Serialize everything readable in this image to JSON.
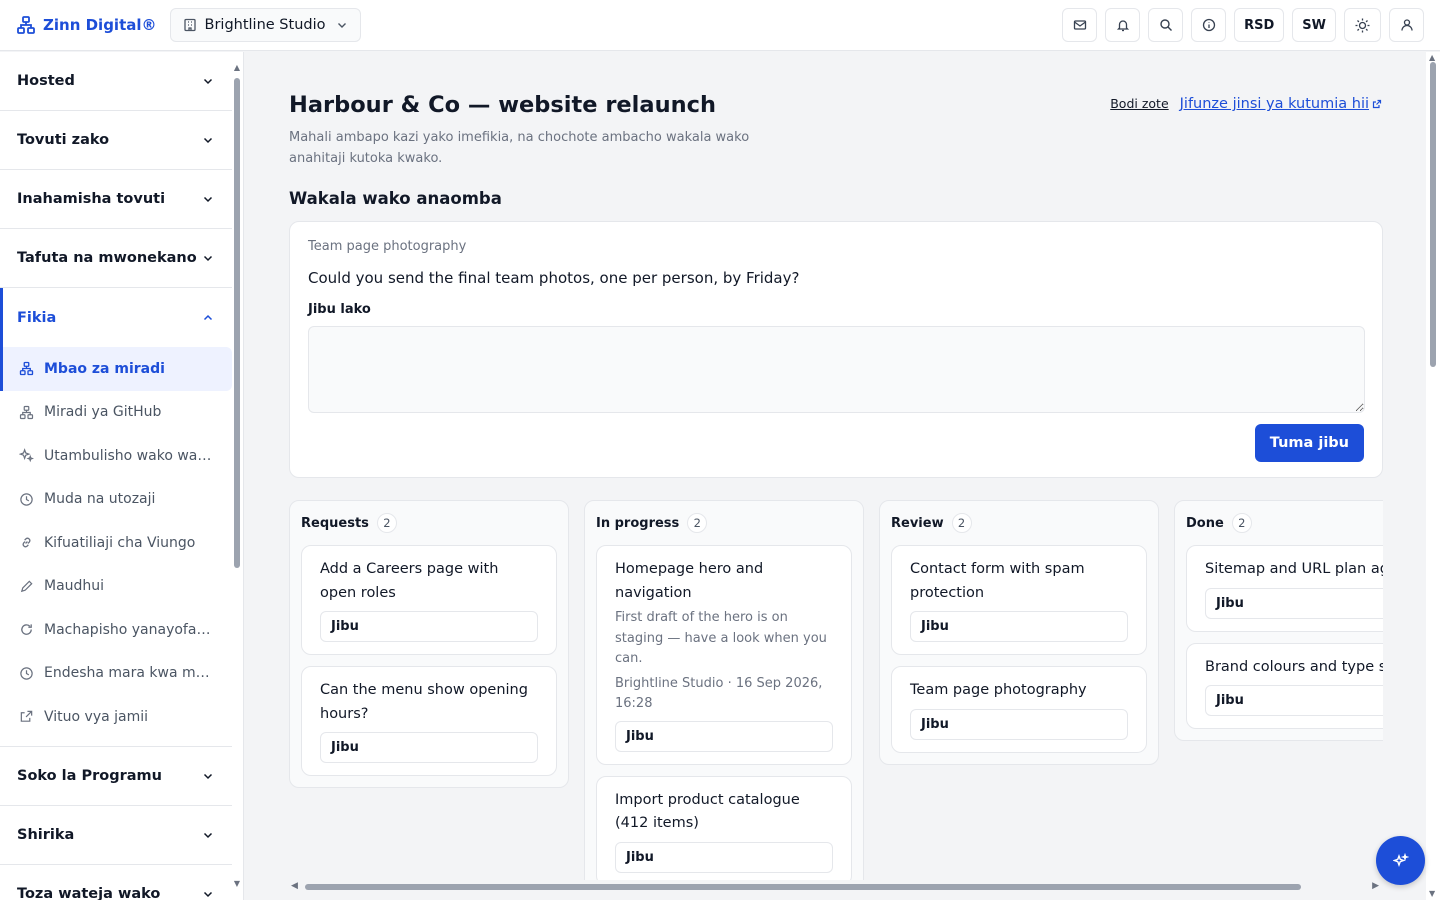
{
  "header": {
    "brand": "Zinn Digital®",
    "workspace": "Brightline Studio",
    "currency": "RSD",
    "language": "SW"
  },
  "sidebar": {
    "sections_top": [
      {
        "label": "Hosted"
      },
      {
        "label": "Tovuti zako"
      },
      {
        "label": "Inahamisha tovuti"
      },
      {
        "label": "Tafuta na mwonekano"
      }
    ],
    "open_section": {
      "label": "Fikia"
    },
    "items": [
      {
        "label": "Mbao za miradi",
        "icon": "boards-icon"
      },
      {
        "label": "Miradi ya GitHub",
        "icon": "github-icon"
      },
      {
        "label": "Utambulisho wako wa chapa",
        "icon": "sparkle-icon"
      },
      {
        "label": "Muda na utozaji",
        "icon": "clock-icon"
      },
      {
        "label": "Kifuatiliaji cha Viungo",
        "icon": "link-icon"
      },
      {
        "label": "Maudhui",
        "icon": "pencil-icon"
      },
      {
        "label": "Machapisho yanayofanyika",
        "icon": "refresh-icon"
      },
      {
        "label": "Endesha mara kwa mara",
        "icon": "clock-icon"
      },
      {
        "label": "Vituo vya jamii",
        "icon": "external-icon"
      }
    ],
    "sections_bottom": [
      {
        "label": "Soko la Programu"
      },
      {
        "label": "Shirika"
      },
      {
        "label": "Toza wateja wako"
      }
    ]
  },
  "page": {
    "title": "Harbour & Co — website relaunch",
    "subtitle": "Mahali ambapo kazi yako imefikia, na chochote ambacho wakala wako anahitaji kutoka kwako.",
    "link_all": "Bodi zote",
    "link_learn": "Jifunze jinsi ya kutumia hii",
    "section_title": "Wakala wako anaomba"
  },
  "request": {
    "subject": "Team page photography",
    "question": "Could you send the final team photos, one per person, by Friday?",
    "answer_label": "Jibu lako",
    "answer_value": "",
    "submit": "Tuma jibu"
  },
  "board": {
    "reply_label": "Jibu",
    "columns": [
      {
        "name": "Requests",
        "count": "2",
        "cards": [
          {
            "title": "Add a Careers page with open roles"
          },
          {
            "title": "Can the menu show opening hours?"
          }
        ]
      },
      {
        "name": "In progress",
        "count": "2",
        "cards": [
          {
            "title": "Homepage hero and navigation",
            "note": "First draft of the hero is on staging — have a look when you can.",
            "meta": "Brightline Studio · 16 Sep 2026, 16:28"
          },
          {
            "title": "Import product catalogue (412 items)"
          }
        ]
      },
      {
        "name": "Review",
        "count": "2",
        "cards": [
          {
            "title": "Contact form with spam protection"
          },
          {
            "title": "Team page photography"
          }
        ]
      },
      {
        "name": "Done",
        "count": "2",
        "cards": [
          {
            "title": "Sitemap and URL plan agreed"
          },
          {
            "title": "Brand colours and type set"
          }
        ]
      }
    ]
  },
  "colors": {
    "accent": "#1d4ed8",
    "border": "#e5e7eb",
    "muted": "#6b7280"
  }
}
